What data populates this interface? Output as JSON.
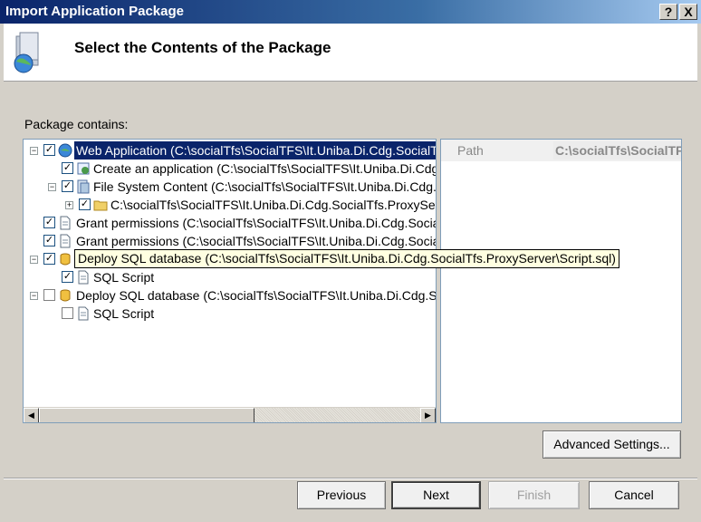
{
  "window": {
    "title": "Import Application Package",
    "help_label": "?",
    "close_label": "X"
  },
  "header": {
    "title": "Select the Contents of the Package"
  },
  "package": {
    "label": "Package contains:",
    "tree": [
      {
        "text": "Web Application (C:\\socialTfs\\SocialTFS\\It.Uniba.Di.Cdg.SocialTfs.",
        "checked": true,
        "expander": "−",
        "selected": true
      },
      {
        "text": "Create an application (C:\\socialTfs\\SocialTFS\\It.Uniba.Di.Cdg.S",
        "checked": true
      },
      {
        "text": "File System Content (C:\\socialTfs\\SocialTFS\\It.Uniba.Di.Cdg.Sc",
        "checked": true,
        "expander": "−"
      },
      {
        "text": "C:\\socialTfs\\SocialTFS\\It.Uniba.Di.Cdg.SocialTfs.ProxyServe",
        "checked": true,
        "expander": "+"
      },
      {
        "text": "Grant permissions (C:\\socialTfs\\SocialTFS\\It.Uniba.Di.Cdg.SocialTf",
        "checked": true
      },
      {
        "text": "Grant permissions (C:\\socialTfs\\SocialTFS\\It.Uniba.Di.Cdg.SocialTf",
        "checked": true
      },
      {
        "text": "Deploy SQL database (C:\\socialTfs\\SocialTFS\\It.Uniba.Di.Cdg.SocialTfs.ProxyServer\\Script.sql)",
        "checked": true,
        "expander": "−",
        "tooltip": true
      },
      {
        "text": "SQL Script",
        "checked": true
      },
      {
        "text": "Deploy SQL database (C:\\socialTfs\\SocialTFS\\It.Uniba.Di.Cdg.Soc",
        "checked": false,
        "expander": "−"
      },
      {
        "text": "SQL Script",
        "checked": false
      }
    ]
  },
  "properties": {
    "key": "Path",
    "value": "C:\\socialTfs\\SocialTF"
  },
  "buttons": {
    "advanced": "Advanced Settings...",
    "previous": "Previous",
    "next": "Next",
    "finish": "Finish",
    "cancel": "Cancel"
  },
  "icons": {
    "header": "package-globe-icon",
    "web_app": "globe-icon",
    "create_app": "app-icon",
    "file_system": "file-system-icon",
    "folder": "folder-icon",
    "permissions": "document-icon",
    "sql_db": "database-icon",
    "sql_script": "script-icon"
  }
}
